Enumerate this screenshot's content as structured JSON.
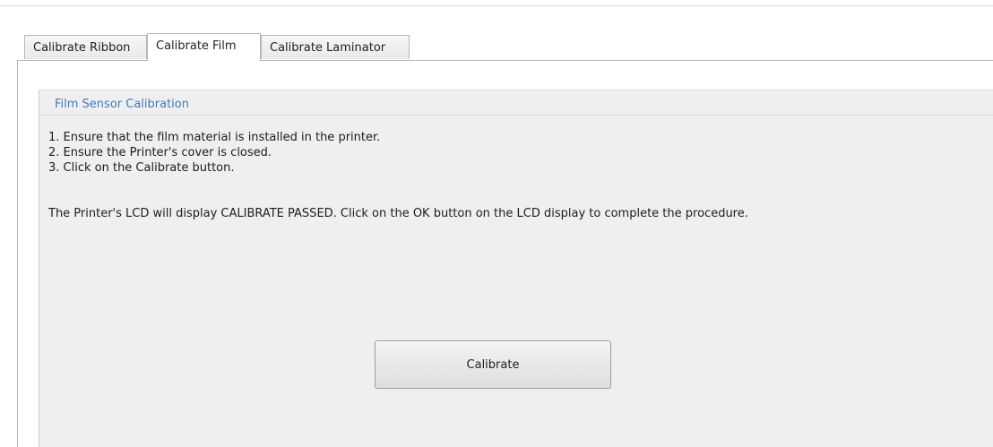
{
  "tabs": [
    {
      "label": "Calibrate Ribbon",
      "active": false
    },
    {
      "label": "Calibrate Film",
      "active": true
    },
    {
      "label": "Calibrate Laminator",
      "active": false
    }
  ],
  "section": {
    "title": "Film Sensor Calibration",
    "steps": [
      "1. Ensure that the film material is installed in the printer.",
      "2. Ensure the Printer's cover is closed.",
      "3. Click on the Calibrate button."
    ],
    "note": "The Printer's LCD will display CALIBRATE PASSED.  Click on the OK button on the LCD display to complete the procedure."
  },
  "actions": {
    "calibrate_label": "Calibrate"
  },
  "colors": {
    "section_title": "#3f7bbf",
    "panel_background": "#efefef",
    "border": "#b7b7b7"
  }
}
